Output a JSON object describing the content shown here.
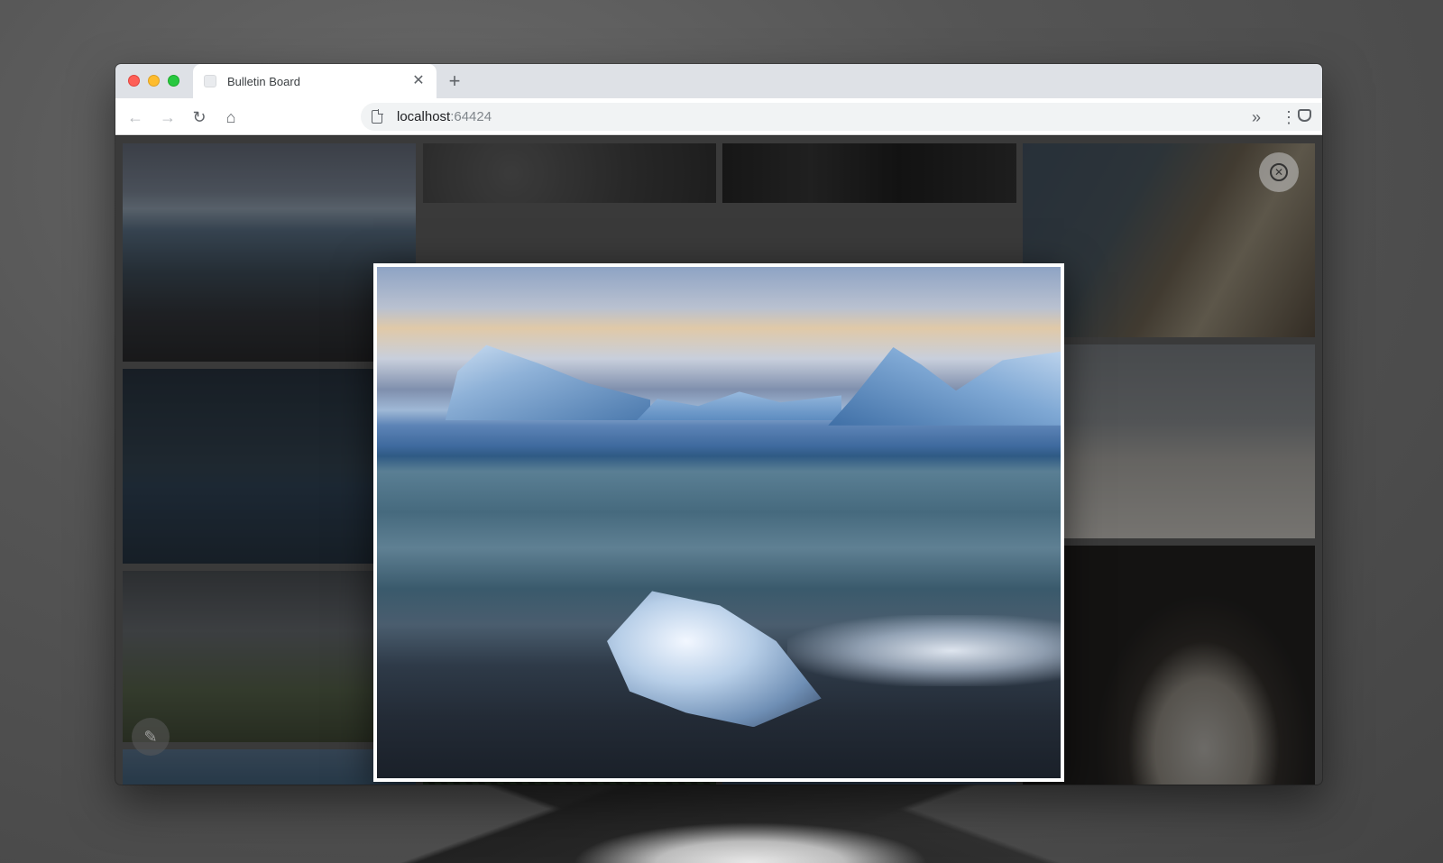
{
  "browser": {
    "tab_title": "Bulletin Board",
    "tab_close": "✕",
    "new_tab": "+",
    "url_host": "localhost",
    "url_port": ":64424",
    "nav": {
      "back": "←",
      "forward": "→",
      "reload": "↻",
      "home": "⌂"
    },
    "star": "☆",
    "extensions": "»",
    "menu": "⋮"
  },
  "lightbox": {
    "close_glyph": "✕"
  },
  "tools": {
    "glyph": "✎"
  },
  "icons": {
    "page": "page-icon",
    "pocket": "pocket-icon",
    "star": "star-icon",
    "close": "close-circle-icon",
    "wrench": "wrench-icon"
  },
  "colors": {
    "tab_strip": "#dee1e6",
    "toolbar": "#ffffff",
    "omnibox": "#f1f3f4",
    "traffic_close": "#fe5f57",
    "traffic_min": "#febc2e",
    "traffic_max": "#28c840"
  }
}
